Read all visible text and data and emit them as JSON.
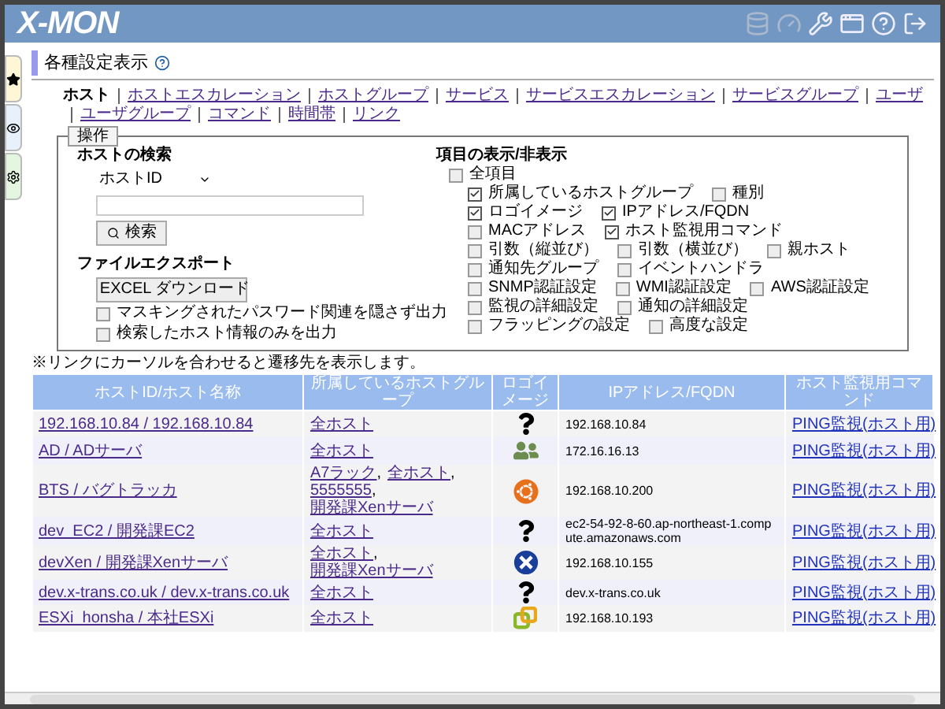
{
  "header": {
    "logo": "X-MON"
  },
  "side_tabs": [
    {
      "kind": "star"
    },
    {
      "kind": "eye"
    },
    {
      "kind": "gear"
    }
  ],
  "page_title": "各種設定表示",
  "nav": [
    {
      "label": "ホスト",
      "selected": true
    },
    {
      "label": "ホストエスカレーション",
      "selected": false
    },
    {
      "label": "ホストグループ",
      "selected": false
    },
    {
      "label": "サービス",
      "selected": false
    },
    {
      "label": "サービスエスカレーション",
      "selected": false
    },
    {
      "label": "サービスグループ",
      "selected": false
    },
    {
      "label": "ユーザ",
      "selected": false
    },
    {
      "label": "ユーザグループ",
      "selected": false
    },
    {
      "label": "コマンド",
      "selected": false
    },
    {
      "label": "時間帯",
      "selected": false
    },
    {
      "label": "リンク",
      "selected": false
    }
  ],
  "operations": {
    "legend": "操作",
    "search": {
      "title": "ホストの検索",
      "select_value": "ホストID",
      "button": "検索"
    },
    "export": {
      "title": "ファイルエクスポート",
      "button": "EXCEL ダウンロード",
      "options": [
        {
          "label": "マスキングされたパスワード関連を隠さず出力",
          "checked": false
        },
        {
          "label": "検索したホスト情報のみを出力",
          "checked": false
        }
      ]
    },
    "columns": {
      "title": "項目の表示/非表示",
      "all": {
        "label": "全項目",
        "checked": false
      },
      "rows": [
        [
          {
            "label": "所属しているホストグループ",
            "checked": true
          },
          {
            "label": "種別",
            "checked": false
          }
        ],
        [
          {
            "label": "ロゴイメージ",
            "checked": true
          },
          {
            "label": "IPアドレス/FQDN",
            "checked": true
          }
        ],
        [
          {
            "label": "MACアドレス",
            "checked": false
          },
          {
            "label": "ホスト監視用コマンド",
            "checked": true
          }
        ],
        [
          {
            "label": "引数（縦並び）",
            "checked": false
          },
          {
            "label": "引数（横並び）",
            "checked": false
          },
          {
            "label": "親ホスト",
            "checked": false
          }
        ],
        [
          {
            "label": "通知先グループ",
            "checked": false
          },
          {
            "label": "イベントハンドラ",
            "checked": false
          }
        ],
        [
          {
            "label": "SNMP認証設定",
            "checked": false
          },
          {
            "label": "WMI認証設定",
            "checked": false
          },
          {
            "label": "AWS認証設定",
            "checked": false
          }
        ],
        [
          {
            "label": "監視の詳細設定",
            "checked": false
          },
          {
            "label": "通知の詳細設定",
            "checked": false
          }
        ],
        [
          {
            "label": "フラッピングの設定",
            "checked": false
          },
          {
            "label": "高度な設定",
            "checked": false
          }
        ]
      ]
    }
  },
  "note": "※リンクにカーソルを合わせると遷移先を表示します。",
  "table": {
    "columns": [
      "ホストID/ホスト名称",
      "所属しているホストグループ",
      "ロゴイメージ",
      "IPアドレス/FQDN",
      "ホスト監視用コマンド"
    ],
    "group_separator": ",",
    "rows": [
      {
        "host": "192.168.10.84 / 192.168.10.84",
        "groups": [
          "全ホスト"
        ],
        "kind": "unknown",
        "address": "192.168.10.84",
        "command": "PING監視(ホスト用)"
      },
      {
        "host": "AD / ADサーバ",
        "groups": [
          "全ホスト"
        ],
        "kind": "users",
        "address": "172.16.16.13",
        "command": "PING監視(ホスト用)"
      },
      {
        "host": "BTS / バグトラッカ",
        "groups": [
          "A7ラック",
          "全ホスト",
          "5555555",
          "開発課Xenサーバ"
        ],
        "kind": "ubuntu",
        "address": "192.168.10.200",
        "command": "PING監視(ホスト用)"
      },
      {
        "host": "dev_EC2 / 開発課EC2",
        "groups": [
          "全ホスト"
        ],
        "kind": "unknown",
        "address": "ec2-54-92-8-60.ap-northeast-1.compute.amazonaws.com",
        "command": "PING監視(ホスト用)"
      },
      {
        "host": "devXen / 開発課Xenサーバ",
        "groups": [
          "全ホスト",
          "開発課Xenサーバ"
        ],
        "kind": "xen",
        "address": "192.168.10.155",
        "command": "PING監視(ホスト用)"
      },
      {
        "host": "dev.x-trans.co.uk / dev.x-trans.co.uk",
        "groups": [
          "全ホスト"
        ],
        "kind": "unknown",
        "address": "dev.x-trans.co.uk",
        "command": "PING監視(ホスト用)"
      },
      {
        "host": "ESXi_honsha / 本社ESXi",
        "groups": [
          "全ホスト"
        ],
        "kind": "vmware",
        "address": "192.168.10.193",
        "command": "PING監視(ホスト用)"
      }
    ]
  }
}
